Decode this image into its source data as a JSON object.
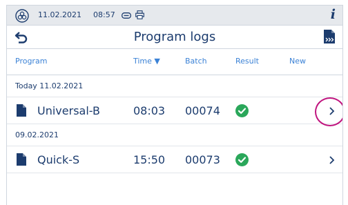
{
  "status": {
    "date": "11.02.2021",
    "time": "08:57",
    "info_label": "i",
    "icons": [
      "device-logo-icon",
      "card-icon",
      "printer-icon",
      "info-icon"
    ]
  },
  "header": {
    "title": "Program logs",
    "icons": [
      "back-arrow-icon",
      "export-icon"
    ]
  },
  "columns": {
    "program": "Program",
    "time": "Time ▼",
    "batch": "Batch",
    "result": "Result",
    "new": "New"
  },
  "groups": [
    {
      "label": "Today 11.02.2021",
      "rows": [
        {
          "program": "Universal-B",
          "time": "08:03",
          "batch": "00074",
          "result_icon": "check-circle-icon"
        }
      ]
    },
    {
      "label": "09.02.2021",
      "rows": [
        {
          "program": "Quick-S",
          "time": "15:50",
          "batch": "00073",
          "result_icon": "check-circle-icon"
        }
      ]
    }
  ],
  "colors": {
    "text": "#1c3c6e",
    "accent": "#3b82d6",
    "success": "#2aa75a",
    "highlight": "#c0157f",
    "statusbar": "#e6e9ed"
  }
}
